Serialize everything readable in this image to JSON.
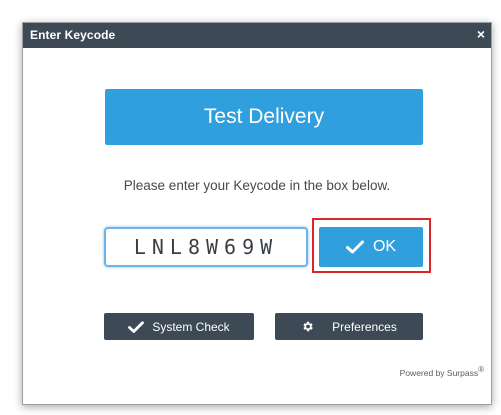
{
  "dialog": {
    "title": "Enter Keycode",
    "close_glyph": "×"
  },
  "banner": {
    "label": "Test Delivery",
    "color": "#2f9fde"
  },
  "prompt": "Please enter your Keycode in the box below.",
  "keycode": {
    "value": "LNL8W69W",
    "placeholder": ""
  },
  "ok_button": {
    "label": "OK",
    "icon": "checkmark-icon"
  },
  "system_check_button": {
    "label": "System Check",
    "icon": "checkmark-icon"
  },
  "preferences_button": {
    "label": "Preferences",
    "icon": "gear-icon"
  },
  "footer": {
    "powered_by": "Powered by Surpass",
    "registered": "®"
  },
  "colors": {
    "titlebar": "#3d4a55",
    "accent": "#2f9fde",
    "highlight": "#d9262b"
  }
}
